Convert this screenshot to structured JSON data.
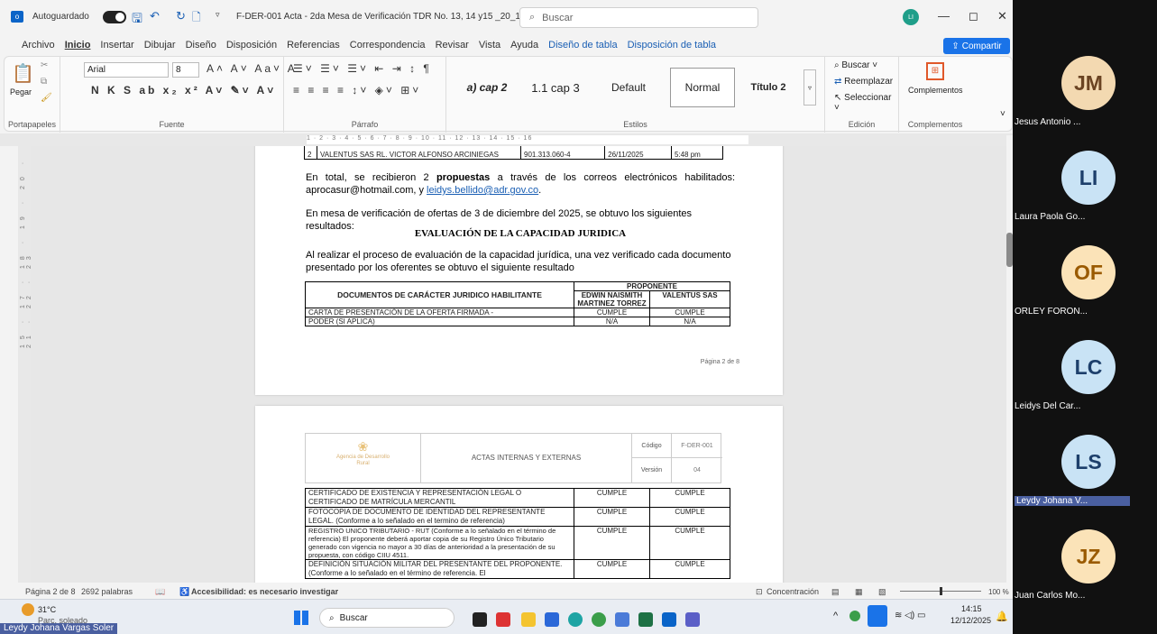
{
  "window": {
    "autosave_label": "Autoguardado",
    "doc_title": "F-DER-001 Acta - 2da Mesa de Verificación TDR No. 13, 14 y15 _20_11_2... ∨",
    "search_placeholder": "Buscar",
    "user_initials": "LI"
  },
  "menu": {
    "items": [
      "Archivo",
      "Inicio",
      "Insertar",
      "Dibujar",
      "Diseño",
      "Disposición",
      "Referencias",
      "Correspondencia",
      "Revisar",
      "Vista",
      "Ayuda",
      "Diseño de tabla",
      "Disposición de tabla"
    ],
    "share": "Compartir"
  },
  "ribbon": {
    "paste": "Pegar",
    "font_name": "Arial",
    "font_size": "8",
    "groups": [
      "Portapapeles",
      "Fuente",
      "Párrafo",
      "Estilos",
      "Edición",
      "Complementos"
    ],
    "styles": [
      "a) cap 2",
      "1.1 cap 3",
      "Default",
      "Normal",
      "Título 2"
    ],
    "edit": [
      "Buscar",
      "Reemplazar",
      "Seleccionar"
    ],
    "addins": "Complementos"
  },
  "ruler_text": "1 · 2 · 3 · 4 · 5 · 6 · 7 · 8 · 9 · 10 · 11 · 12 · 13 · 14 · 15 · 16",
  "vruler_text": "15 · 17 · 18 · 19 · 20 · 21 · 22 · 23",
  "page1": {
    "table_row": [
      "2",
      "VALENTUS SAS RL. VICTOR ALFONSO ARCINIEGAS",
      "901.313.060-4",
      "26/11/2025",
      "5:48 pm"
    ],
    "para1_a": "En total, se recibieron 2 ",
    "para1_b": "propuestas",
    "para1_c": " a través de los correos electrónicos habilitados: aprocasur@hotmail.com, y ",
    "para1_link": "leidys.bellido@adr.gov.co",
    "para1_end": ".",
    "para2": "En mesa de verificación de ofertas de 3 de diciembre del 2025, se obtuvo los siguientes resultados:",
    "heading": "EVALUACIÓN DE LA CAPACIDAD JURIDICA",
    "para3": "Al realizar el proceso de evaluación de la capacidad jurídica, una vez verificado cada documento presentado por los oferentes se obtuvo el siguiente resultado",
    "eval_header": {
      "docs": "DOCUMENTOS DE CARÁCTER JURIDICO HABILITANTE",
      "proponente": "PROPONENTE",
      "p1": "EDWIN NAISMITH MARTINEZ TORREZ",
      "p2": "VALENTUS SAS"
    },
    "eval_rows": [
      [
        "CARTA DE PRESENTACIÓN DE LA OFERTA FIRMADA -",
        "CUMPLE",
        "CUMPLE"
      ],
      [
        "PODER (SI APLICA)",
        "N/A",
        "N/A"
      ]
    ],
    "page_number": "Página 2 de 8"
  },
  "page2": {
    "logo_text": "Agencia de Desarrollo Rural",
    "header_title": "ACTAS INTERNAS Y EXTERNAS",
    "codigo_label": "Código",
    "codigo_value": "F-DER-001",
    "version_label": "Versión",
    "version_value": "04",
    "rows": [
      [
        "CERTIFICADO DE EXISTENCIA Y REPRESENTACIÓN LEGAL O CERTIFICADO DE MATRÍCULA MERCANTIL",
        "CUMPLE",
        "CUMPLE"
      ],
      [
        "FOTOCOPIA DE DOCUMENTO DE IDENTIDAD DEL REPRESENTANTE LEGAL. (Conforme a lo señalado en el termino de referencia)",
        "CUMPLE",
        "CUMPLE"
      ],
      [
        "REGISTRO UNICO TRIBUTARIO - RUT (Conforme a lo señalado en el término de referencia) El proponente deberá aportar copia de su Registro Único Tributario generado con vigencia no mayor a 30 días de anterioridad a la presentación de su propuesta, con código CIIU 4511.",
        "CUMPLE",
        "CUMPLE"
      ],
      [
        "DEFINICIÓN SITUACIÓN MILITAR DEL PRESENTANTE DEL PROPONENTE. (Conforme a lo señalado en el término de referencia. El",
        "CUMPLE",
        "CUMPLE"
      ]
    ]
  },
  "status": {
    "page": "Página 2 de 8",
    "words": "2692 palabras",
    "accessibility": "Accesibilidad: es necesario investigar",
    "focus": "Concentración",
    "zoom": "100 %"
  },
  "taskbar": {
    "temp": "31°C",
    "weather": "Parc. soleado",
    "search": "Buscar",
    "time": "14:15",
    "date": "12/12/2025"
  },
  "participants": [
    {
      "initials": "JM",
      "name": "Jesus Antonio ...",
      "color": "#f3d9b1",
      "text": "#6b4423"
    },
    {
      "initials": "LI",
      "name": "Laura Paola Go...",
      "color": "#c9e3f5",
      "text": "#1d3f6b"
    },
    {
      "initials": "OF",
      "name": "ORLEY FORON...",
      "color": "#fbe3b8",
      "text": "#9a5a00"
    },
    {
      "initials": "LC",
      "name": "Leidys Del Car...",
      "color": "#c9e3f5",
      "text": "#1d3f6b"
    },
    {
      "initials": "LS",
      "name": "Leydy Johana V...",
      "color": "#c9e3f5",
      "text": "#1d3f6b"
    },
    {
      "initials": "JZ",
      "name": "Juan Carlos Mo...",
      "color": "#fbe3b8",
      "text": "#9a5a00"
    }
  ],
  "speaker_tag": "Leydy Johana Vargas Soler"
}
